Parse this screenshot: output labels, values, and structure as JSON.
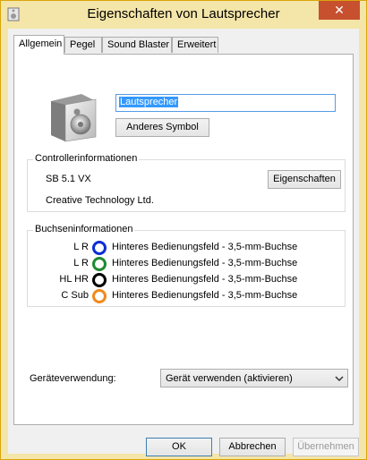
{
  "window": {
    "title": "Eigenschaften von Lautsprecher",
    "close_glyph": "✕"
  },
  "tabs": [
    {
      "label": "Allgemein",
      "active": true
    },
    {
      "label": "Pegel",
      "active": false
    },
    {
      "label": "Sound Blaster",
      "active": false
    },
    {
      "label": "Erweitert",
      "active": false
    }
  ],
  "general": {
    "icon": "speaker-icon",
    "name_value": "Lautsprecher",
    "change_icon_button": "Anderes Symbol"
  },
  "controller": {
    "group_label": "Controllerinformationen",
    "device_name": "SB 5.1 VX",
    "manufacturer": "Creative Technology Ltd.",
    "properties_button": "Eigenschaften"
  },
  "jacks": {
    "group_label": "Buchseninformationen",
    "rows": [
      {
        "channels": "L R",
        "color": "#0b2ed6",
        "location": "Hinteres Bedienungsfeld - 3,5-mm-Buchse"
      },
      {
        "channels": "L R",
        "color": "#1e8a2e",
        "location": "Hinteres Bedienungsfeld - 3,5-mm-Buchse"
      },
      {
        "channels": "HL HR",
        "color": "#000000",
        "location": "Hinteres Bedienungsfeld - 3,5-mm-Buchse"
      },
      {
        "channels": "C Sub",
        "color": "#f08a1c",
        "location": "Hinteres Bedienungsfeld - 3,5-mm-Buchse"
      }
    ]
  },
  "usage": {
    "label": "Geräteverwendung:",
    "selected": "Gerät verwenden (aktivieren)"
  },
  "footer": {
    "ok": "OK",
    "cancel": "Abbrechen",
    "apply": "Übernehmen"
  },
  "colors": {
    "frame": "#f4e5a8",
    "close_button": "#c7502f",
    "selection": "#3399ff"
  }
}
